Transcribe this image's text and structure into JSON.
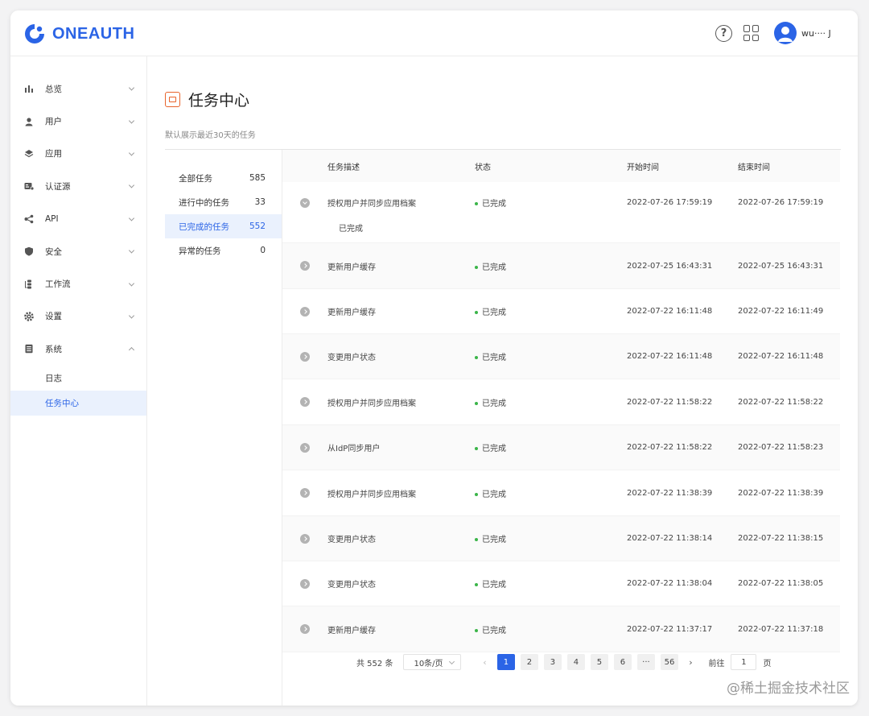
{
  "brand": {
    "name": "ONEAUTH",
    "color": "#2b64e6"
  },
  "header": {
    "help_icon": "question-circle-icon",
    "apps_icon": "grid-icon",
    "user_name": "wu···· J"
  },
  "sidebar": {
    "items": [
      {
        "label": "总览",
        "icon": "bar-chart-icon"
      },
      {
        "label": "用户",
        "icon": "user-icon"
      },
      {
        "label": "应用",
        "icon": "layers-icon"
      },
      {
        "label": "认证源",
        "icon": "id-card-icon"
      },
      {
        "label": "API",
        "icon": "share-icon"
      },
      {
        "label": "安全",
        "icon": "shield-icon"
      },
      {
        "label": "工作流",
        "icon": "workflow-icon"
      },
      {
        "label": "设置",
        "icon": "gear-icon"
      },
      {
        "label": "系统",
        "icon": "system-icon"
      }
    ],
    "sub_items": [
      {
        "label": "日志"
      },
      {
        "label": "任务中心"
      }
    ]
  },
  "page": {
    "title": "任务中心",
    "subtitle": "默认展示最近30天的任务"
  },
  "filters": [
    {
      "label": "全部任务",
      "count": "585"
    },
    {
      "label": "进行中的任务",
      "count": "33"
    },
    {
      "label": "已完成的任务",
      "count": "552"
    },
    {
      "label": "异常的任务",
      "count": "0"
    }
  ],
  "table": {
    "headers": {
      "desc": "任务描述",
      "status": "状态",
      "start": "开始时间",
      "end": "结束时间"
    },
    "expanded_detail": "已完成",
    "rows": [
      {
        "desc": "授权用户并同步应用档案",
        "status": "已完成",
        "start": "2022-07-26 17:59:19",
        "end": "2022-07-26 17:59:19"
      },
      {
        "desc": "更新用户缓存",
        "status": "已完成",
        "start": "2022-07-25 16:43:31",
        "end": "2022-07-25 16:43:31"
      },
      {
        "desc": "更新用户缓存",
        "status": "已完成",
        "start": "2022-07-22 16:11:48",
        "end": "2022-07-22 16:11:49"
      },
      {
        "desc": "变更用户状态",
        "status": "已完成",
        "start": "2022-07-22 16:11:48",
        "end": "2022-07-22 16:11:48"
      },
      {
        "desc": "授权用户并同步应用档案",
        "status": "已完成",
        "start": "2022-07-22 11:58:22",
        "end": "2022-07-22 11:58:22"
      },
      {
        "desc": "从IdP同步用户",
        "status": "已完成",
        "start": "2022-07-22 11:58:22",
        "end": "2022-07-22 11:58:23"
      },
      {
        "desc": "授权用户并同步应用档案",
        "status": "已完成",
        "start": "2022-07-22 11:38:39",
        "end": "2022-07-22 11:38:39"
      },
      {
        "desc": "变更用户状态",
        "status": "已完成",
        "start": "2022-07-22 11:38:14",
        "end": "2022-07-22 11:38:15"
      },
      {
        "desc": "变更用户状态",
        "status": "已完成",
        "start": "2022-07-22 11:38:04",
        "end": "2022-07-22 11:38:05"
      },
      {
        "desc": "更新用户缓存",
        "status": "已完成",
        "start": "2022-07-22 11:37:17",
        "end": "2022-07-22 11:37:18"
      }
    ]
  },
  "pagination": {
    "total": "共 552 条",
    "page_size": "10条/页",
    "pages": [
      "1",
      "2",
      "3",
      "4",
      "5",
      "6",
      "···",
      "56"
    ],
    "current": "1",
    "goto_label": "前往",
    "goto_value": "1",
    "goto_suffix": "页"
  },
  "watermark": "@稀土掘金技术社区",
  "colors": {
    "accent": "#2b64e6",
    "status_ok": "#3bb549",
    "title_icon": "#e8632b"
  }
}
